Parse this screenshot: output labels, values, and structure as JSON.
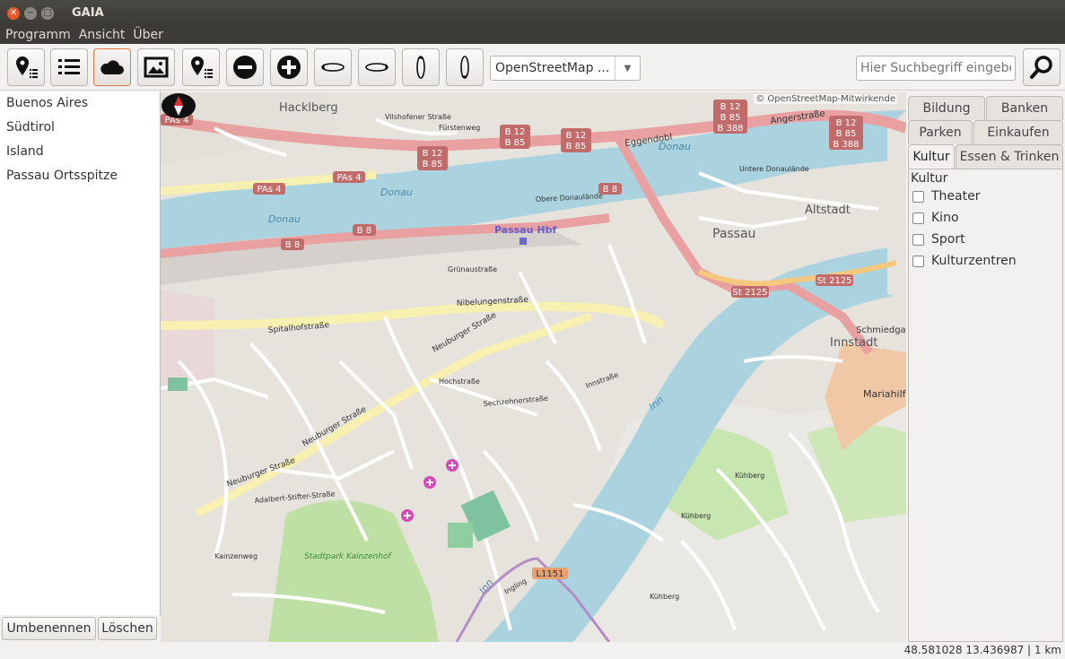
{
  "window": {
    "title": "GAIA"
  },
  "menu": {
    "items": [
      "Programm",
      "Ansicht",
      "Über"
    ]
  },
  "toolbar": {
    "layer_select": "OpenStreetMap ...",
    "search_placeholder": "Hier Suchbegriff eingeben"
  },
  "places": {
    "items": [
      "Buenos Aires",
      "Südtirol",
      "Island",
      "Passau Ortsspitze"
    ],
    "rename_label": "Umbenennen",
    "delete_label": "Löschen"
  },
  "map": {
    "attribution": "© OpenStreetMap-Mitwirkende",
    "labels": {
      "hacklberg": "Hacklberg",
      "donau1": "Donau",
      "donau2": "Donau",
      "donau3": "Donau",
      "passau_hbf": "Passau Hbf",
      "passau": "Passau",
      "altstadt": "Altstadt",
      "innstadt": "Innstadt",
      "inn1": "Inn",
      "inn2": "Inn",
      "mariahilfberg": "Mariahilfberg",
      "eggendobl": "Eggendobl",
      "angerstrasse": "Angerstraße",
      "nibelungenstrasse": "Nibelungenstraße",
      "neuburger1": "Neuburger Straße",
      "neuburger2": "Neuburger Straße",
      "neuburger3": "Neuburger Straße",
      "spitalhofstrasse": "Spitalhofstraße",
      "schmiedgasse": "Schmiedgasse",
      "stadtpark": "Stadtpark Kainzenhof",
      "vilshofener": "Vilshofener Straße",
      "fuerstenweg": "Fürstenweg",
      "innstrasse": "Innstraße",
      "hochstrasse": "Hochstraße",
      "gruenaustrasse": "Grünaustraße",
      "kuehberg1": "Kühberg",
      "kuehberg2": "Kühberg",
      "kuehberg3": "Kühberg",
      "ingling": "Ingling",
      "kainzenweg": "Kainzenweg",
      "sechzehner": "Sechzehnerstraße",
      "adalbert": "Adalbert-Stifter-Straße",
      "obere_donaulaende": "Obere Donaulände",
      "untere_donaulaende": "Untere Donaulände"
    },
    "shields": {
      "pas4a": "PAs 4",
      "pas4b": "PAs 4",
      "pas4c": "PAs 4",
      "b8a": "B 8",
      "b8b": "B 8",
      "b8c": "B 8",
      "b12a": "B 12",
      "b85a": "B 85",
      "b12b": "B 12",
      "b85b": "B 85",
      "b12c": "B 12",
      "b85c": "B 85",
      "b388c": "B 388",
      "b12d": "B 12",
      "b85d": "B 85",
      "b388d": "B 388",
      "st2125a": "St 2125",
      "st2125b": "St 2125",
      "l1151": "L1151"
    }
  },
  "categories": {
    "tabs_row1": [
      "Bildung",
      "Banken"
    ],
    "tabs_row2": [
      "Parken",
      "Einkaufen"
    ],
    "tabs_row3": [
      "Kultur",
      "Essen & Trinken"
    ],
    "active_tab": "Kultur",
    "heading": "Kultur",
    "options": [
      "Theater",
      "Kino",
      "Sport",
      "Kulturzentren"
    ]
  },
  "status": {
    "coordinates": "48.581028 13.436987 | 1 km"
  }
}
